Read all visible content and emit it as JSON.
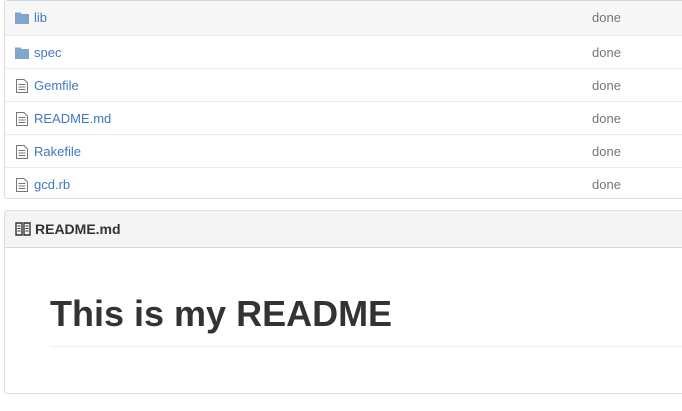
{
  "files": [
    {
      "name": "lib",
      "type": "folder",
      "icon": "folder-icon",
      "status": "done"
    },
    {
      "name": "spec",
      "type": "folder",
      "icon": "folder-icon",
      "status": "done"
    },
    {
      "name": "Gemfile",
      "type": "file",
      "icon": "file-icon",
      "status": "done"
    },
    {
      "name": "README.md",
      "type": "file",
      "icon": "file-icon",
      "status": "done"
    },
    {
      "name": "Rakefile",
      "type": "file",
      "icon": "file-icon",
      "status": "done"
    },
    {
      "name": "gcd.rb",
      "type": "file",
      "icon": "file-icon",
      "status": "done"
    }
  ],
  "readme": {
    "header_title": "README.md",
    "header_icon": "book-icon",
    "heading": "This is my README"
  },
  "colors": {
    "link": "#4078c0",
    "folder": "#80a6cd",
    "status": "#767676"
  }
}
